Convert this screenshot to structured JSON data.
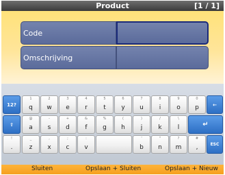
{
  "header": {
    "title": "Product",
    "pager": "[1 / 1]"
  },
  "form": {
    "fields": [
      {
        "label": "Code",
        "value": ""
      },
      {
        "label": "Omschrijving",
        "value": ""
      }
    ]
  },
  "keyboard": {
    "row1": {
      "mode": "12?",
      "keys": [
        {
          "sub": "1",
          "main": "q"
        },
        {
          "sub": "2",
          "main": "w"
        },
        {
          "sub": "3",
          "main": "e"
        },
        {
          "sub": "4",
          "main": "r"
        },
        {
          "sub": "5",
          "main": "t"
        },
        {
          "sub": "6",
          "main": "y"
        },
        {
          "sub": "7",
          "main": "u"
        },
        {
          "sub": "8",
          "main": "i"
        },
        {
          "sub": "9",
          "main": "o"
        },
        {
          "sub": "0",
          "main": "p"
        }
      ],
      "backspace": "←"
    },
    "row2": {
      "shift": "⇧",
      "keys": [
        {
          "sub": "@",
          "main": "a"
        },
        {
          "sub": "-",
          "main": "s"
        },
        {
          "sub": "+",
          "main": "d"
        },
        {
          "sub": "&",
          "main": "f"
        },
        {
          "sub": "%",
          "main": "g"
        },
        {
          "sub": "(",
          "main": "h"
        },
        {
          "sub": ")",
          "main": "j"
        },
        {
          "sub": "/",
          "main": "k"
        },
        {
          "sub": "\\",
          "main": "l"
        }
      ],
      "enter": "↵"
    },
    "row3": {
      "keys_left": [
        {
          "sub": "!",
          "main": "."
        },
        {
          "sub": "_",
          "main": "z"
        },
        {
          "sub": ",",
          "main": "x"
        },
        {
          "sub": ";",
          "main": "c"
        },
        {
          "sub": ":",
          "main": "v"
        }
      ],
      "space": "",
      "keys_right": [
        {
          "sub": "'",
          "main": "b"
        },
        {
          "sub": "\"",
          "main": "n"
        },
        {
          "sub": "?",
          "main": "m"
        },
        {
          "sub": "#",
          "main": ","
        }
      ],
      "esc": "ESC"
    }
  },
  "footer": {
    "close_label": "Sluiten",
    "save_close_label": "Opslaan + Sluiten",
    "save_new_label": "Opslaan + Nieuw"
  },
  "colors": {
    "header_bg": "#4a4a4a",
    "form_bg": "#ffe27a",
    "field_bg": "#6978a4",
    "keyboard_bg": "#ccd3dc",
    "special_key": "#3b7fd6",
    "footer_bg": "#ffad30"
  }
}
